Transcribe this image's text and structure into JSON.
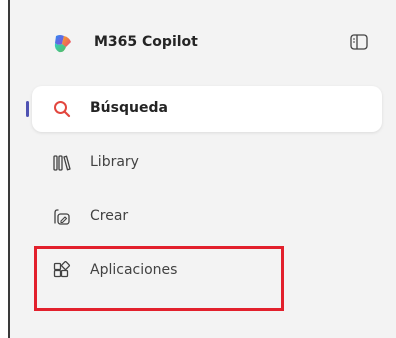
{
  "app": {
    "title": "M365 Copilot",
    "logo_icon": "m365-copilot-logo-icon",
    "panel_toggle_icon": "sidebar-panel-toggle-icon"
  },
  "nav": {
    "items": [
      {
        "label": "Búsqueda",
        "icon": "search-icon",
        "active": true
      },
      {
        "label": "Library",
        "icon": "library-icon",
        "active": false
      },
      {
        "label": "Crear",
        "icon": "create-icon",
        "active": false
      },
      {
        "label": "Aplicaciones",
        "icon": "apps-icon",
        "active": false
      }
    ]
  },
  "colors": {
    "sidebar_bg": "#f3f3f3",
    "accent": "#4f52b2",
    "search_icon": "#e2473f",
    "annotation_red": "#e2202c"
  }
}
